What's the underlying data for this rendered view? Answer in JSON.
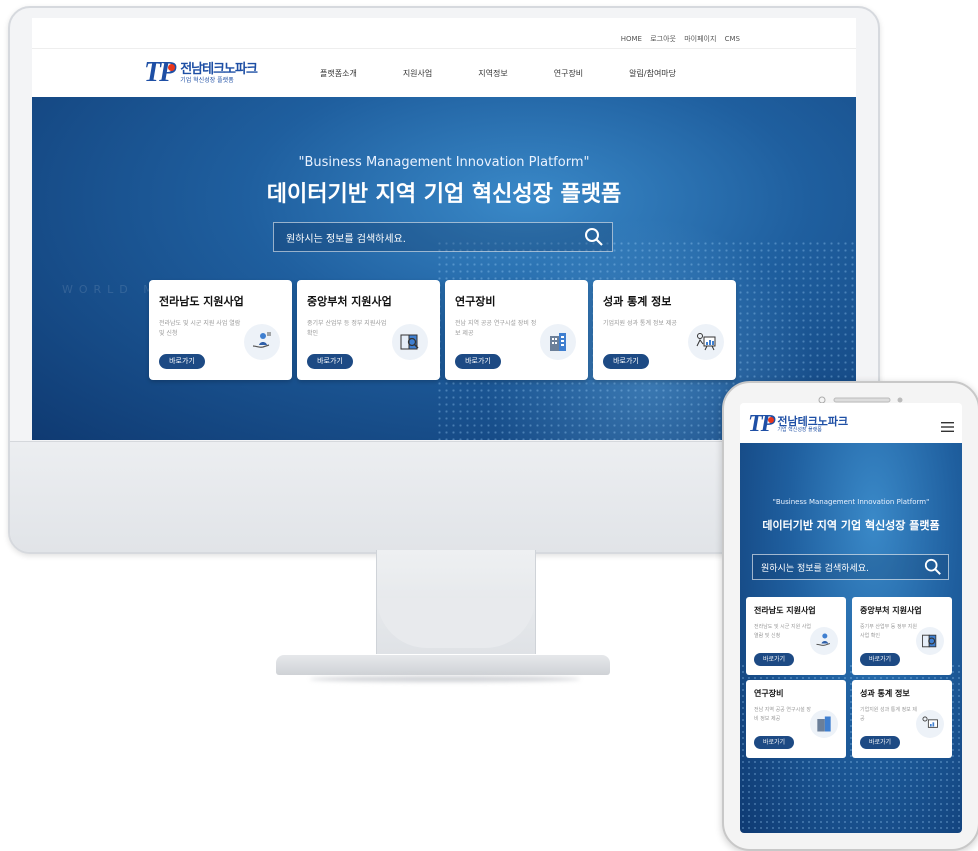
{
  "top_links": [
    "HOME",
    "로그아웃",
    "마이페이지",
    "CMS"
  ],
  "logo": {
    "mark": "TP",
    "name": "전남테크노파크",
    "sub": "기업 혁신성장 플랫폼"
  },
  "menu": [
    "플랫폼소개",
    "지원사업",
    "지역정보",
    "연구장비",
    "알림/참여마당"
  ],
  "hero": {
    "bg_text": "WORLD MA",
    "tagline": "\"Business Management Innovation Platform\"",
    "headline": "데이터기반 지역 기업 혁신성장 플랫폼",
    "search_placeholder": "원하시는 정보를 검색하세요."
  },
  "cards": [
    {
      "title": "전라남도 지원사업",
      "desc": "전라남도 및 시군 지원 사업 열람 및 신청",
      "button": "바로가기",
      "icon": "hand-person-icon"
    },
    {
      "title": "중앙부처 지원사업",
      "desc": "중기부 산업부 등 정부 지원사업 확인",
      "button": "바로가기",
      "icon": "book-magnifier-icon"
    },
    {
      "title": "연구장비",
      "desc": "전남 지역 공공 연구시설 장비 정보 제공",
      "button": "바로가기",
      "icon": "building-icon"
    },
    {
      "title": "성과 통계 정보",
      "desc": "기업지원 성과 통계 정보 제공",
      "button": "바로가기",
      "icon": "presentation-chart-icon"
    }
  ],
  "colors": {
    "brand_blue": "#1e4fa5",
    "button_navy": "#1d4a84",
    "logo_dot": "#e8361c"
  }
}
